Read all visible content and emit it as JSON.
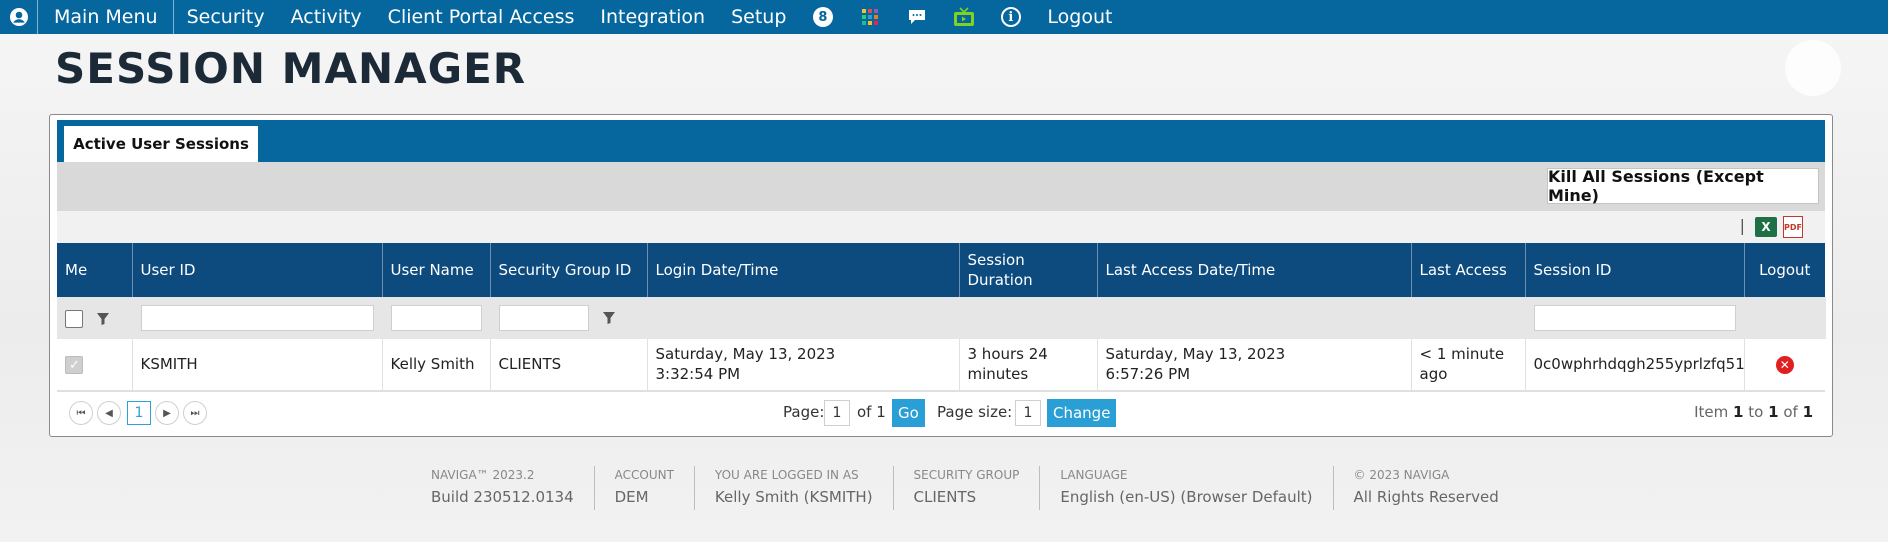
{
  "nav": {
    "items": [
      "Main Menu",
      "Security",
      "Activity",
      "Client Portal Access",
      "Integration",
      "Setup"
    ],
    "badge_count": "8",
    "logout": "Logout"
  },
  "page_title": "SESSION MANAGER",
  "tab_label": "Active User Sessions",
  "kill_button": "Kill All Sessions (Except Mine)",
  "export": {
    "separator": "|",
    "xls_icon": "excel-icon",
    "pdf_icon": "pdf-icon",
    "pdf_text": "PDF"
  },
  "grid": {
    "columns": [
      "Me",
      "User ID",
      "User Name",
      "Security Group ID",
      "Login Date/Time",
      "Session Duration",
      "Last Access Date/Time",
      "Last Access",
      "Session ID",
      "Logout"
    ],
    "rows": [
      {
        "me_checked": true,
        "user_id": "KSMITH",
        "user_name": "Kelly Smith",
        "security_group": "CLIENTS",
        "login_date": "Saturday, May 13, 2023",
        "login_time": "3:32:54 PM",
        "duration_1": "3 hours 24",
        "duration_2": "minutes",
        "last_access_date": "Saturday, May 13, 2023",
        "last_access_time": "6:57:26 PM",
        "last_access_1": "< 1 minute",
        "last_access_2": "ago",
        "session_id": "0c0wphrhdqgh255yprlzfq51"
      }
    ]
  },
  "pager": {
    "current": "1",
    "page_label": "Page:",
    "page_value": "1",
    "of_label": "of 1",
    "go": "Go",
    "size_label": "Page size:",
    "size_value": "1",
    "change": "Change",
    "item_prefix": "Item",
    "item_from": "1",
    "to": "to",
    "item_to": "1",
    "of": "of",
    "item_total": "1"
  },
  "footer": [
    {
      "label": "NAVIGA™ 2023.2",
      "value": "Build 230512.0134"
    },
    {
      "label": "ACCOUNT",
      "value": "DEM"
    },
    {
      "label": "YOU ARE LOGGED IN AS",
      "value": "Kelly Smith (KSMITH)"
    },
    {
      "label": "SECURITY GROUP",
      "value": "CLIENTS"
    },
    {
      "label": "LANGUAGE",
      "value": "English (en-US) (Browser Default)"
    },
    {
      "label": "© 2023 NAVIGA",
      "value": "All Rights Reserved"
    }
  ],
  "colors": {
    "nav_bg": "#05679e",
    "header_bg": "#0d4a7e",
    "accent": "#2a9fd6",
    "danger": "#e02020"
  }
}
